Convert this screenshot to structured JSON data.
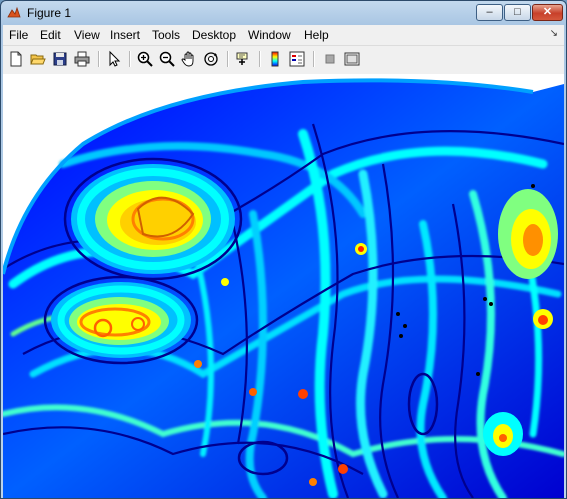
{
  "window": {
    "title": "Figure 1"
  },
  "controls": {
    "minimize": "‒",
    "maximize": "□",
    "close": "✕"
  },
  "menu": [
    "File",
    "Edit",
    "View",
    "Insert",
    "Tools",
    "Desktop",
    "Window",
    "Help"
  ],
  "dock_arrow": "↘",
  "toolbar": [
    {
      "name": "new-figure-icon"
    },
    {
      "name": "open-file-icon"
    },
    {
      "name": "save-icon"
    },
    {
      "name": "print-icon"
    },
    {
      "name": "edit-plot-arrow-icon"
    },
    {
      "name": "zoom-in-icon"
    },
    {
      "name": "zoom-out-icon"
    },
    {
      "name": "pan-hand-icon"
    },
    {
      "name": "rotate-3d-icon"
    },
    {
      "name": "data-cursor-icon"
    },
    {
      "name": "insert-colorbar-icon"
    },
    {
      "name": "insert-legend-icon"
    },
    {
      "name": "hide-plot-tools-icon"
    },
    {
      "name": "show-plot-tools-icon"
    }
  ],
  "figure": {
    "colormap": [
      "#00008f",
      "#0000ff",
      "#0080ff",
      "#00ffff",
      "#80ff80",
      "#ffff00",
      "#ff8000",
      "#ff0000"
    ]
  }
}
